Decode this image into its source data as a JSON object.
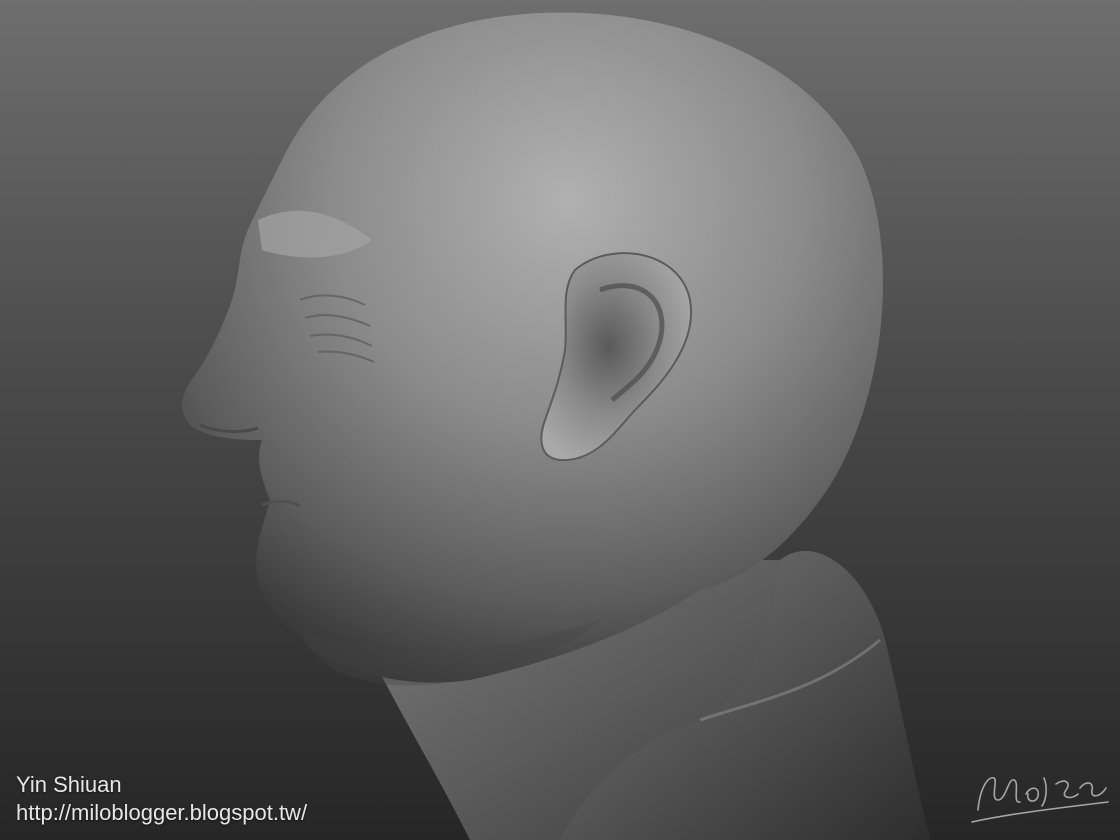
{
  "artwork": {
    "background_top": "#6e6e6e",
    "background_bottom": "#262626",
    "clay_color": "#8c8c8c"
  },
  "credits": {
    "artist_name": "Yin Shiuan",
    "blog_url": "http://miloblogger.blogspot.tw/"
  },
  "signature": {
    "text": "Milo Shia"
  }
}
